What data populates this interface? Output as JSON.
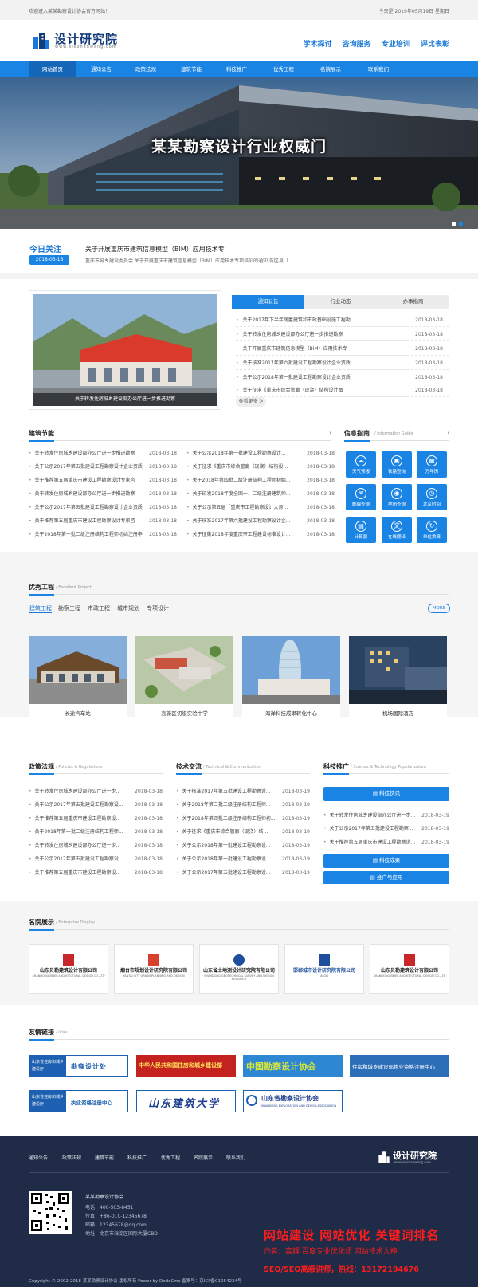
{
  "topbar": {
    "welcome": "欢迎进入某某勘察设计协会官方网站！",
    "date": "今天是 2019年05月19日 星期日"
  },
  "logo": {
    "title": "设计研究院",
    "url": "www.xiezhanwang.com"
  },
  "header_links": [
    "学术探讨",
    "咨询服务",
    "专业培训",
    "评比表彰"
  ],
  "nav": [
    "网站首页",
    "通知公告",
    "政策法规",
    "建筑节能",
    "科技推广",
    "优秀工程",
    "名院展示",
    "联系我们"
  ],
  "banner": {
    "caption": "某某勘察设计行业权威门"
  },
  "today": {
    "label": "今日关注",
    "date": "2018-03-18",
    "headline": "关于开展重庆市建筑信息模型（BIM）应用技术专",
    "summary": "重庆市城乡建设委员会 关于开展重庆市建筑信息模型（BIM）应用技术专项培训的通知 各区县（......"
  },
  "feature": {
    "caption": "关于转发住房城乡建设部办公厅进一步推进勘察"
  },
  "news_tabs": [
    "通知公告",
    "行业动态",
    "办事指南"
  ],
  "news": [
    {
      "t": "关于2017年下半年房屋建筑和市政基础设施工程勘",
      "d": "2018-03-18"
    },
    {
      "t": "关于转发住房城乡建设部办公厅进一步推进勘察",
      "d": "2018-03-18"
    },
    {
      "t": "关于开展重庆市建筑信息模型（BIM）应用技术专",
      "d": "2018-03-18"
    },
    {
      "t": "关于核准2017年第六批建设工程勘察设计企业资质",
      "d": "2018-03-18"
    },
    {
      "t": "关于公示2018年第一批建设工程勘察设计企业资质",
      "d": "2018-03-18"
    },
    {
      "t": "关于征求《重庆市综合管廊（现浇）结构设计图",
      "d": "2018-03-18"
    }
  ],
  "news_more": "查看更多 >",
  "energy": {
    "title": "建筑节能",
    "left": [
      {
        "t": "关于转发住房城乡建设部办公厅进一步推进勘察",
        "d": "2018-03-18"
      },
      {
        "t": "关于公示2017年第五批建设工程勘察设计企业资质",
        "d": "2018-03-18"
      },
      {
        "t": "关于推荐第五届重庆市建设工程勘察设计专家咨",
        "d": "2018-03-18"
      },
      {
        "t": "关于转发住房城乡建设部办公厅进一步推进勘察",
        "d": "2018-03-18"
      },
      {
        "t": "关于公示2017年第五批建设工程勘察设计企业资质",
        "d": "2018-03-18"
      },
      {
        "t": "关于推荐第五届重庆市建设工程勘察设计专家咨",
        "d": "2018-03-18"
      },
      {
        "t": "关于2018年第一批二级注册结构工程师初始注册申",
        "d": "2018-03-18"
      }
    ],
    "right": [
      {
        "t": "关于公示2018年第一批建设工程勘察设计...",
        "d": "2018-03-18"
      },
      {
        "t": "关于征求《重庆市综合管廊（现浇）结构设...",
        "d": "2018-03-18"
      },
      {
        "t": "关于2018年第四批二级注册结构工程师初始...",
        "d": "2018-03-18"
      },
      {
        "t": "关于印发2018年度全国一、二级注册建筑师...",
        "d": "2018-03-18"
      },
      {
        "t": "关于公示第五届「重庆市工程勘察设计大师...",
        "d": "2018-03-18"
      },
      {
        "t": "关于核准2017年第六批建设工程勘察设计企...",
        "d": "2018-03-18"
      },
      {
        "t": "关于征集2018年度重庆市工程建设标准设计...",
        "d": "2018-03-18"
      }
    ]
  },
  "info": {
    "title": "信息指南",
    "sub": "/ Information Guide",
    "items": [
      "天气预报",
      "铁路查询",
      "万年历",
      "邮编查询",
      "地图查询",
      "北京时间",
      "计算器",
      "在线翻译",
      "单位换算"
    ]
  },
  "projects": {
    "title": "优秀工程",
    "sub": "/ Excellent Project",
    "tabs": [
      "建筑工程",
      "勘察工程",
      "市政工程",
      "城市规划",
      "专项设计"
    ],
    "more": "MORE",
    "items": [
      "长途汽车站",
      "高新区初级实验中学",
      "海洋科技成果转化中心",
      "机场国际酒店"
    ]
  },
  "policy": {
    "title": "政策法规",
    "sub": "/ Policies & Regulations",
    "items": [
      {
        "t": "关于转发住房城乡建设部办公厅进一步...",
        "d": "2018-03-18"
      },
      {
        "t": "关于公示2017年第五批建设工程勘察设...",
        "d": "2018-03-18"
      },
      {
        "t": "关于推荐第五届重庆市建设工程勘察设...",
        "d": "2018-03-18"
      },
      {
        "t": "关于2018年第一批二级注册结构工程师...",
        "d": "2018-03-18"
      },
      {
        "t": "关于转发住房城乡建设部办公厅进一步...",
        "d": "2018-03-18"
      },
      {
        "t": "关于公示2017年第五批建设工程勘察设...",
        "d": "2018-03-18"
      },
      {
        "t": "关于推荐第五届重庆市建设工程勘察设...",
        "d": "2018-03-18"
      }
    ]
  },
  "tech": {
    "title": "技术交流",
    "sub": "/ Technical & Communication",
    "items": [
      {
        "t": "关于核准2017年第五批建设工程勘察设...",
        "d": "2018-03-19"
      },
      {
        "t": "关于2018年第二批二级注册结构工程师...",
        "d": "2018-03-19"
      },
      {
        "t": "关于2018年第四批二级注册结构工程师初...",
        "d": "2018-03-19"
      },
      {
        "t": "关于征求《重庆市综合管廊（现浇）结...",
        "d": "2018-03-19"
      },
      {
        "t": "关于公示2018年第一批建设工程勘察设...",
        "d": "2018-03-19"
      },
      {
        "t": "关于公示2018年第一批建设工程勘察设...",
        "d": "2018-03-19"
      },
      {
        "t": "关于公示2017年第五批建设工程勘察设...",
        "d": "2018-03-19"
      }
    ]
  },
  "science": {
    "title": "科技推广",
    "sub": "/ Science & Technology Popularization",
    "btn1": "科技快讯",
    "items": [
      {
        "t": "关于转发住房城乡建设部办公厅进一步...",
        "d": "2018-03-19"
      },
      {
        "t": "关于公示2017年第五批建设工程勘察...",
        "d": "2018-03-19"
      },
      {
        "t": "关于推荐第五届重庆市建设工程勘察设...",
        "d": "2018-03-19"
      }
    ],
    "btn2": "科技成果",
    "btn3": "推广与应用"
  },
  "enterprise": {
    "title": "名院展示",
    "sub": "/ Enterprise Display",
    "logos": [
      {
        "n": "山东贝勒建筑设计有限公司",
        "e": "SHANDONG BEIEL ARCHITECTURAL DESIGN CO.,LTD"
      },
      {
        "n": "烟台市规划设计研究院有限公司",
        "e": "YANTAI CITY URBAN PLANNING AND DESIGN"
      },
      {
        "n": "山东省土地测设计研究院有限公司",
        "e": "SHANDONG GEOTECHNICAL SURVEY AND DESIGN RESEARCH"
      },
      {
        "n": "邯郸城市设计研究院有限公司",
        "e": "ALGN"
      },
      {
        "n": "山东贝勒建筑设计有限公司",
        "e": "SHANDONG BEIEL ARCHITECTURAL DESIGN CO.,LTD"
      }
    ]
  },
  "links": {
    "title": "友情链接",
    "sub": "/ links",
    "l1a": "山东省住房和城乡建设厅",
    "l1b": "勘察设计处",
    "l2": "中华人民共和国住房和城乡建设部",
    "l3": "中国勘察设计协会",
    "l4": "住房和城乡建设部执业资格注册中心",
    "l5a": "山东省住房和城乡建设厅",
    "l5b": "执业资格注册中心",
    "l6": "山东建筑大学",
    "l7": "山东省勘察设计协会",
    "l7e": "SHANDONG EXPLORATION AND DESIGN ASSOCIATION"
  },
  "footer": {
    "nav": [
      "通知公告",
      "政策法规",
      "建筑节能",
      "科技推广",
      "优秀工程",
      "名院展示",
      "联系我们"
    ],
    "logo": "设计研究院",
    "logo_url": "www.xiezhanwang.com",
    "org": "某某勘察设计协会",
    "tel": "电话：400-503-8451",
    "fax": "传真：+86-010-12345678",
    "mail": "邮箱：12345678@qq.com",
    "addr": "地址：北京市海淀区国际大厦CBD",
    "copy": "Copyright © 2002-2018 某某勘察设计协会 版权所有 Power by DedeCms 备案号：京ICP备01054234号",
    "ad1": "网站建设  网站优化  关键词排名",
    "ad2": "作者：高辉    百度专业优化师    网站技术大神",
    "ad3": "SEO/SEO高级讲师，热线：13172194676"
  }
}
